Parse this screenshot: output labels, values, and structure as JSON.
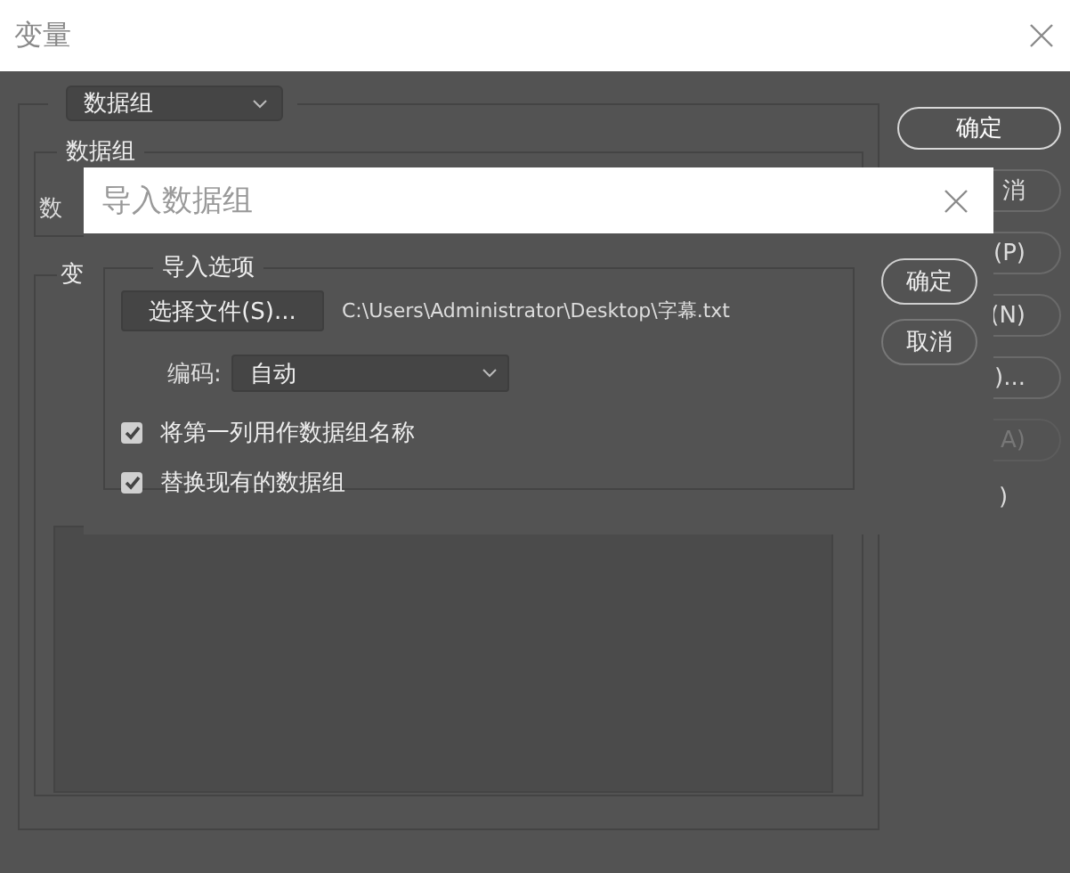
{
  "window": {
    "title": "变量"
  },
  "data_set_dropdown": {
    "value": "数据组"
  },
  "data_group": {
    "legend": "数据组",
    "label": "数"
  },
  "variable_group": {
    "legend": "变"
  },
  "buttons": [
    {
      "label": "确定",
      "kind": "button",
      "default": true,
      "disabled": false
    },
    {
      "label": "消",
      "kind": "button",
      "default": false,
      "disabled": false
    },
    {
      "label": "(P)",
      "kind": "button",
      "default": false,
      "disabled": false
    },
    {
      "label": "(N)",
      "kind": "button",
      "default": false,
      "disabled": false
    },
    {
      "label": ")...",
      "kind": "button",
      "default": false,
      "disabled": false
    },
    {
      "label": "A)",
      "kind": "button",
      "default": false,
      "disabled": true
    },
    {
      "label": ")",
      "kind": "text",
      "disabled": false
    }
  ],
  "import_dialog": {
    "title": "导入数据组",
    "group_legend": "导入选项",
    "choose_file_button": "选择文件(S)...",
    "file_path": "C:\\Users\\Administrator\\Desktop\\字幕.txt",
    "encoding_label": "编码:",
    "encoding_value": "自动",
    "options": [
      {
        "label": "将第一列用作数据组名称",
        "checked": true
      },
      {
        "label": "替换现有的数据组",
        "checked": true
      }
    ],
    "buttons": [
      {
        "label": "确定",
        "default": true
      },
      {
        "label": "取消",
        "default": false
      }
    ]
  }
}
